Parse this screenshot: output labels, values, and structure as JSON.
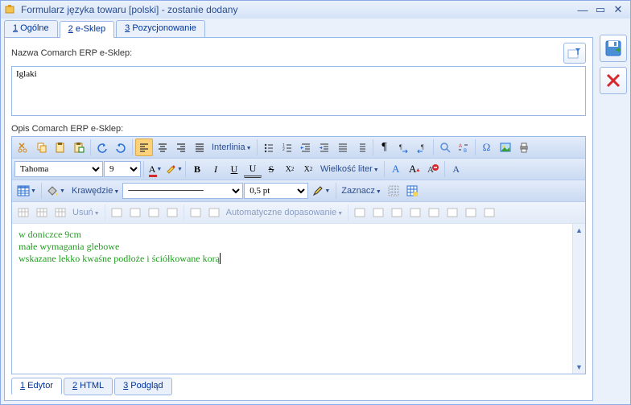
{
  "window": {
    "title": "Formularz języka towaru [polski] - zostanie dodany"
  },
  "top_tabs": [
    {
      "num": "1",
      "label": " Ogólne"
    },
    {
      "num": "2",
      "label": " e-Sklep"
    },
    {
      "num": "3",
      "label": " Pozycjonowanie"
    }
  ],
  "top_tabs_active": 1,
  "name_label": "Nazwa Comarch ERP e-Sklep:",
  "name_value": "Iglaki",
  "desc_label": "Opis Comarch ERP e-Sklep:",
  "font_name": "Tahoma",
  "font_size": "9",
  "toolbar": {
    "interlinia": "Interlinia",
    "wielkosc": "Wielkość liter",
    "krawedzie": "Krawędzie",
    "pt": "0,5 pt",
    "zaznacz": "Zaznacz",
    "usun": "Usuń",
    "auto": "Automatyczne dopasowanie"
  },
  "editor_lines": [
    "w doniczce 9cm",
    "małe wymagania glebowe",
    "wskazane lekko kwaśne podłoże i ściółkowane korą"
  ],
  "bottom_tabs": [
    {
      "num": "1",
      "label": " Edytor"
    },
    {
      "num": "2",
      "label": " HTML"
    },
    {
      "num": "3",
      "label": " Podgląd"
    }
  ],
  "bottom_tabs_active": 0
}
